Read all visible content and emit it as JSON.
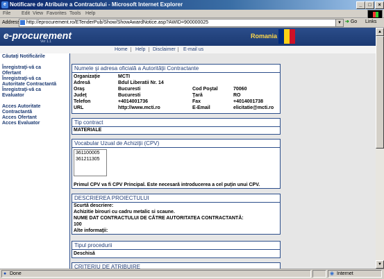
{
  "window": {
    "title": "Notificare de Atribuire a Contractului - Microsoft Internet Explorer",
    "minimize": "_",
    "maximize": "□",
    "close": "×"
  },
  "menu": [
    "File",
    "Edit",
    "View",
    "Favorites",
    "Tools",
    "Help"
  ],
  "address": {
    "label": "Address",
    "url": "http://eprocurement.ro/ETenderPub/Show/ShowAwardNotice.asp?AWID=900000025",
    "go": "Go",
    "links": "Links"
  },
  "header": {
    "logo": "e-procurement",
    "version": "Ver 1.1",
    "country": "Romania",
    "flag_colors": [
      "#002b7f",
      "#fcd116",
      "#ce1126"
    ]
  },
  "topnav": [
    "Home",
    "Help",
    "Disclaimer",
    "E-mail us"
  ],
  "sidebar": {
    "search": "Căutaţi Notificările",
    "register": [
      "Înregistraţi-vă ca",
      "Ofertant",
      "Înregistraţi-vă ca",
      "Autoritate Contractantă",
      "Înregistraţi-vă ca",
      "Evaluator"
    ],
    "access": [
      "Acces Autoritate",
      "Contractantă",
      "Acces Ofertant",
      "Acces Evaluator"
    ]
  },
  "authority": {
    "heading": "Numele şi adresa oficială a Autorităţii Contractante",
    "rows": [
      {
        "label": "Organizaţie",
        "value": "MCTI",
        "label2": "",
        "value2": ""
      },
      {
        "label": "Adresă",
        "value": "Bdul Liberatii Nr. 14",
        "label2": "",
        "value2": ""
      },
      {
        "label": "Oraş",
        "value": "Bucuresti",
        "label2": "Cod Poştal",
        "value2": "70060"
      },
      {
        "label": "Judeţ",
        "value": "Bucuresti",
        "label2": "Ţară",
        "value2": "RO"
      },
      {
        "label": "Telefon",
        "value": "+4014001736",
        "label2": "Fax",
        "value2": "+4014001738"
      },
      {
        "label": "URL",
        "value": "http://www.mcti.ro",
        "label2": "E-Email",
        "value2": "elicitatie@mcti.ro"
      }
    ]
  },
  "contract_type": {
    "heading": "Tip contract",
    "value": "MATERIALE"
  },
  "cpv": {
    "heading": "Vocabular Uzual de Achiziţii (CPV)",
    "codes": [
      "361100005",
      "361211305"
    ],
    "note": "Primul CPV va fi CPV Principal. Este necesară introducerea a cel puţin unui CPV."
  },
  "project": {
    "heading": "DESCRIEREA PROIECTULUI",
    "short_label": "Scurtă descriere:",
    "short_value": "Achizitie birouri cu cadru metalic si scaune.",
    "name_label": "NUME DAT CONTRACTULUI DE CĂTRE AUTORITATEA CONTRACTANTĂ:",
    "name_value": "100",
    "other_label": "Alte informaţii:"
  },
  "procedure": {
    "heading": "Tipul procedurii",
    "value": "Deschisă"
  },
  "criteria": {
    "heading": "CRITERIU DE ATRIBUIRE"
  },
  "status": {
    "text": "Done",
    "zone": "Internet"
  }
}
